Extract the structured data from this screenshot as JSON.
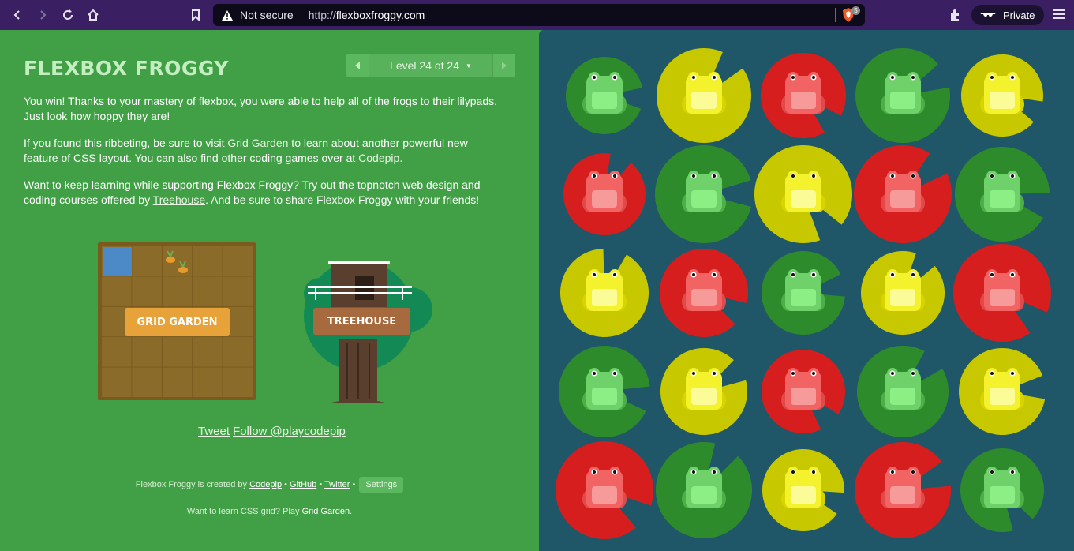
{
  "browser": {
    "security_label": "Not secure",
    "url_prefix": "http://",
    "url_host": "flexboxfroggy.com",
    "shield_count": "5",
    "private_label": "Private",
    "icons": [
      "back-icon",
      "forward-icon",
      "reload-icon",
      "home-icon",
      "bookmark-icon",
      "warning-icon",
      "brave-shield-icon",
      "extensions-icon",
      "private-glasses-icon",
      "menu-icon"
    ]
  },
  "game": {
    "logo": "FLEXBOX FROGGY",
    "level_label": "Level 24 of 24",
    "win_text_1": "You win! Thanks to your mastery of flexbox, you were able to help all of the frogs to their lilypads. Just look how hoppy they are!",
    "win_text_2_a": "If you found this ribbeting, be sure to visit ",
    "win_text_2_link1": "Grid Garden",
    "win_text_2_b": " to learn about another powerful new feature of CSS layout. You can also find other coding games over at ",
    "win_text_2_link2": "Codepip",
    "win_text_2_c": ".",
    "win_text_3_a": "Want to keep learning while supporting Flexbox Froggy? Try out the topnotch web design and coding courses offered by ",
    "win_text_3_link": "Treehouse",
    "win_text_3_b": ". And be sure to share Flexbox Froggy with your friends!",
    "grid_garden_button": "GRID GARDEN",
    "treehouse_button": "TREEHOUSE",
    "tweet_link": "Tweet",
    "follow_link": "Follow @playcodepip",
    "footer_created_by": "Flexbox Froggy is created by ",
    "footer_codepip": "Codepip",
    "footer_github": "GitHub",
    "footer_twitter": "Twitter",
    "footer_settings": "Settings",
    "footer_grid_text": "Want to learn CSS grid? Play ",
    "footer_grid_link": "Grid Garden",
    "footer_grid_end": "."
  },
  "colors": {
    "green_pad": "#2e8b2b",
    "green_frog": "#6fd16a",
    "yellow_pad": "#c8c800",
    "yellow_frog": "#f4f22c",
    "red_pad": "#d61e1e",
    "red_frog": "#f26464"
  },
  "pond": {
    "rows": [
      [
        "green",
        "yellow",
        "red",
        "green",
        "yellow"
      ],
      [
        "red",
        "green",
        "yellow",
        "red",
        "green"
      ],
      [
        "yellow",
        "red",
        "green",
        "yellow",
        "red"
      ],
      [
        "green",
        "yellow",
        "red",
        "green",
        "yellow"
      ],
      [
        "red",
        "green",
        "yellow",
        "red",
        "green"
      ]
    ]
  }
}
